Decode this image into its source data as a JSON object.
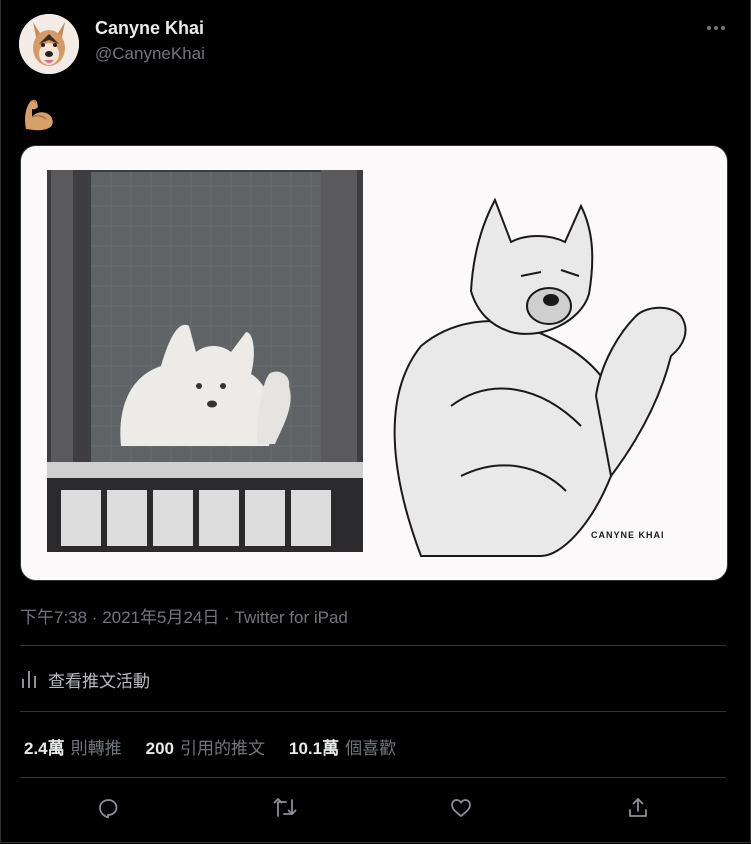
{
  "tweet": {
    "display_name": "Canyne Khai",
    "handle": "@CanyneKhai",
    "text_emoji": "flexed-biceps",
    "timestamp": "下午7:38",
    "date": "2021年5月24日",
    "separator": " · ",
    "source": "Twitter for iPad",
    "media_signature": "CANYNE KHAI"
  },
  "activity": {
    "label": "查看推文活動"
  },
  "stats": [
    {
      "value": "2.4萬",
      "label": "則轉推"
    },
    {
      "value": "200",
      "label": "引用的推文"
    },
    {
      "value": "10.1萬",
      "label": "個喜歡"
    }
  ],
  "colors": {
    "background": "#000000",
    "text_primary": "#e7e9ea",
    "text_secondary": "#71767b",
    "divider": "#2f3336"
  }
}
